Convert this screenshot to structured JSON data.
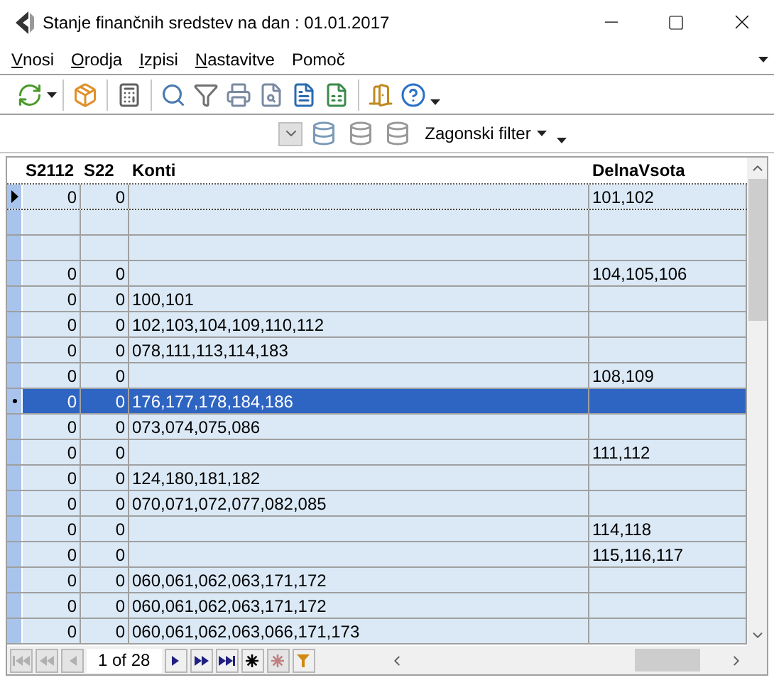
{
  "window": {
    "title": "Stanje finančnih sredstev na dan : 01.01.2017"
  },
  "menu": [
    {
      "label": "Vnosi",
      "underlined": true
    },
    {
      "label": "Orodja",
      "underlined": true
    },
    {
      "label": "Izpisi",
      "underlined": true
    },
    {
      "label": "Nastavitve",
      "underlined": true
    },
    {
      "label": "Pomoč",
      "underlined": false
    }
  ],
  "filter_toolbar": {
    "filter_label": "Zagonski filter"
  },
  "table": {
    "columns": [
      "S2112",
      "S22",
      "Konti",
      "DelnaVsota"
    ],
    "rows": [
      {
        "cells": [
          "0",
          "0",
          "",
          "101,102"
        ],
        "current": true,
        "selected": false
      },
      {
        "cells": [
          "",
          "",
          "",
          ""
        ],
        "current": false,
        "selected": false
      },
      {
        "cells": [
          "",
          "",
          "",
          ""
        ],
        "current": false,
        "selected": false
      },
      {
        "cells": [
          "0",
          "0",
          "",
          "104,105,106"
        ],
        "current": false,
        "selected": false
      },
      {
        "cells": [
          "0",
          "0",
          "100,101",
          ""
        ],
        "current": false,
        "selected": false
      },
      {
        "cells": [
          "0",
          "0",
          "102,103,104,109,110,112",
          ""
        ],
        "current": false,
        "selected": false
      },
      {
        "cells": [
          "0",
          "0",
          "078,111,113,114,183",
          ""
        ],
        "current": false,
        "selected": false
      },
      {
        "cells": [
          "0",
          "0",
          "",
          "108,109"
        ],
        "current": false,
        "selected": false
      },
      {
        "cells": [
          "0",
          "0",
          "176,177,178,184,186",
          ""
        ],
        "current": false,
        "selected": true
      },
      {
        "cells": [
          "0",
          "0",
          "073,074,075,086",
          ""
        ],
        "current": false,
        "selected": false
      },
      {
        "cells": [
          "0",
          "0",
          "",
          "111,112"
        ],
        "current": false,
        "selected": false
      },
      {
        "cells": [
          "0",
          "0",
          "124,180,181,182",
          ""
        ],
        "current": false,
        "selected": false
      },
      {
        "cells": [
          "0",
          "0",
          "070,071,072,077,082,085",
          ""
        ],
        "current": false,
        "selected": false
      },
      {
        "cells": [
          "0",
          "0",
          "",
          "114,118"
        ],
        "current": false,
        "selected": false
      },
      {
        "cells": [
          "0",
          "0",
          "",
          "115,116,117"
        ],
        "current": false,
        "selected": false
      },
      {
        "cells": [
          "0",
          "0",
          "060,061,062,063,171,172",
          ""
        ],
        "current": false,
        "selected": false
      },
      {
        "cells": [
          "0",
          "0",
          "060,061,062,063,171,172",
          ""
        ],
        "current": false,
        "selected": false
      },
      {
        "cells": [
          "0",
          "0",
          "060,061,062,063,066,171,173",
          ""
        ],
        "current": false,
        "selected": false
      }
    ]
  },
  "navigator": {
    "position": "1 of 28",
    "buttons": [
      {
        "kind": "first",
        "disabled": true
      },
      {
        "kind": "prev-page",
        "disabled": true
      },
      {
        "kind": "prev",
        "disabled": true
      },
      {
        "kind": "position",
        "disabled": false
      },
      {
        "kind": "next",
        "disabled": false
      },
      {
        "kind": "next-page",
        "disabled": false
      },
      {
        "kind": "last",
        "disabled": false
      },
      {
        "kind": "new",
        "disabled": false
      },
      {
        "kind": "delete",
        "disabled": true
      },
      {
        "kind": "filter",
        "disabled": false
      }
    ]
  }
}
